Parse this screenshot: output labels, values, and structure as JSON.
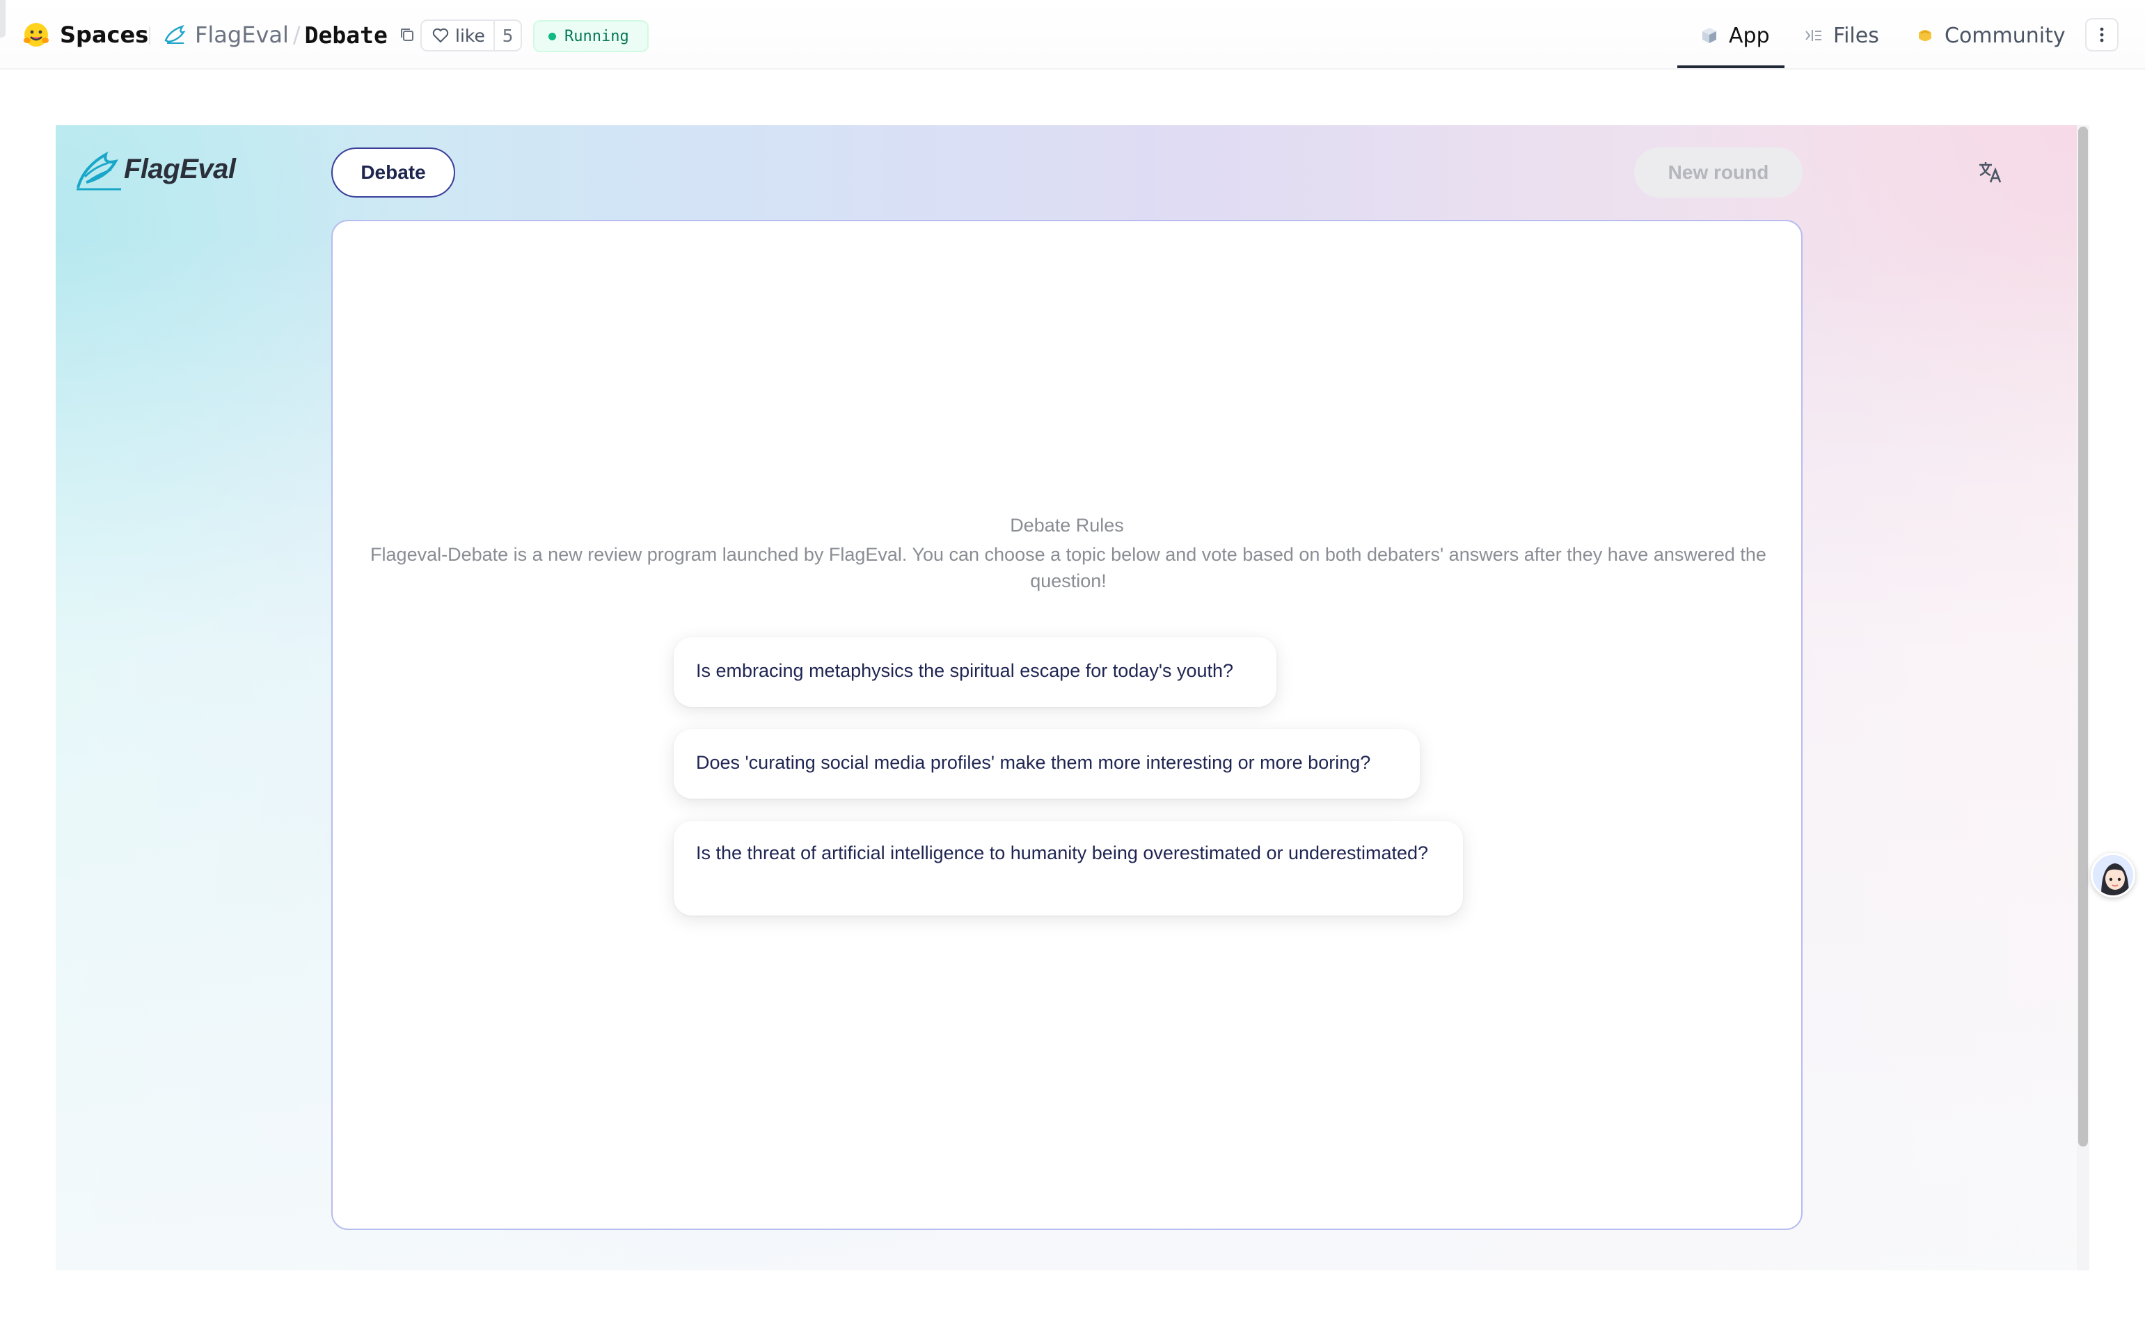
{
  "header": {
    "brand": "Spaces",
    "owner": "FlagEval",
    "separator": "/",
    "space_name": "Debate",
    "like_label": "like",
    "like_count": "5",
    "status": "Running",
    "status_color": "#10b981"
  },
  "nav": {
    "tabs": [
      {
        "label": "App",
        "icon": "app-cube-icon",
        "active": true
      },
      {
        "label": "Files",
        "icon": "files-icon",
        "active": false
      },
      {
        "label": "Community",
        "icon": "community-icon",
        "active": false
      }
    ]
  },
  "app": {
    "logo_text": "FlagEval",
    "mode_button": "Debate",
    "new_round_button": "New round",
    "translate_icon": "translate-icon",
    "accent_color": "#3b3f9a",
    "rules_title": "Debate Rules",
    "rules_body": "Flageval-Debate is a new review program launched by FlagEval. You can choose a topic below and vote based on both debaters' answers after they have answered the question!",
    "topics": [
      "Is embracing metaphysics the spiritual escape for today's youth?",
      "Does 'curating social media profiles' make them more interesting or more boring?",
      "Is the threat of artificial intelligence to humanity being overestimated or underestimated?"
    ]
  }
}
